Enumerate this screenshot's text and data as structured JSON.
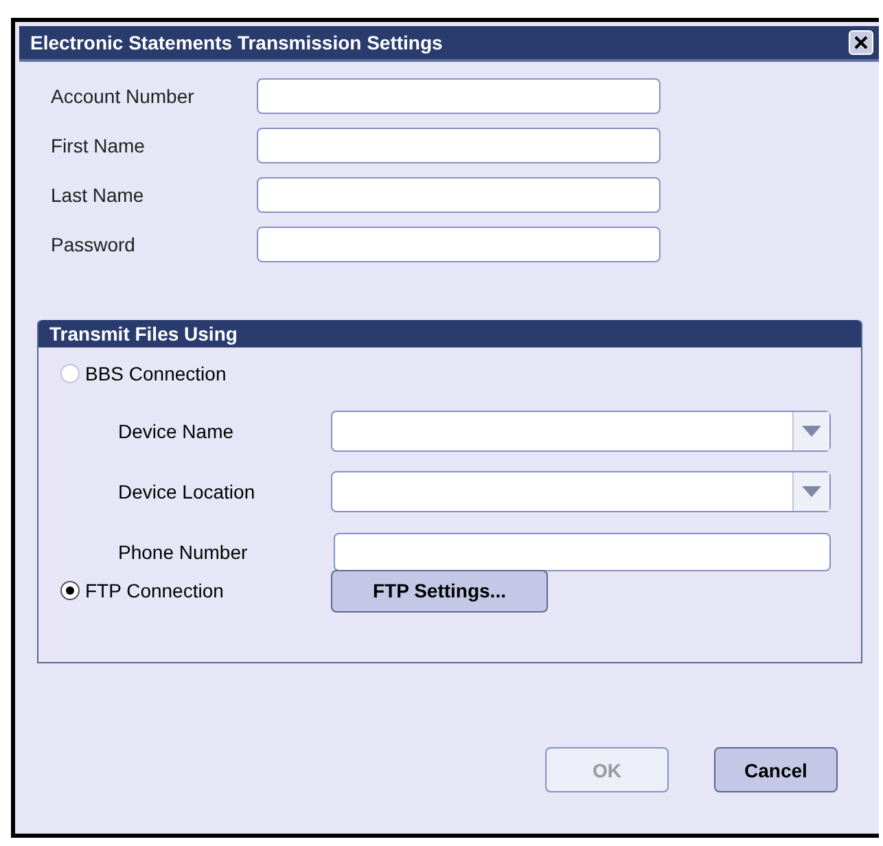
{
  "window": {
    "title": "Electronic Statements Transmission Settings"
  },
  "fields": [
    {
      "label": "Account Number"
    },
    {
      "label": "First Name"
    },
    {
      "label": "Last Name"
    },
    {
      "label": "Password"
    }
  ],
  "group": {
    "title": "Transmit Files Using",
    "options": [
      {
        "label": "BBS Connection",
        "selected": false,
        "fields": [
          {
            "label": "Device Name",
            "kind": "dropdown"
          },
          {
            "label": "Device Location",
            "kind": "dropdown"
          },
          {
            "label": "Phone Number",
            "kind": "text"
          }
        ]
      },
      {
        "label": "FTP Connection",
        "selected": true,
        "button": "FTP Settings..."
      }
    ]
  },
  "buttons": [
    {
      "label": "OK",
      "disabled": true
    },
    {
      "label": "Cancel",
      "disabled": false
    }
  ]
}
